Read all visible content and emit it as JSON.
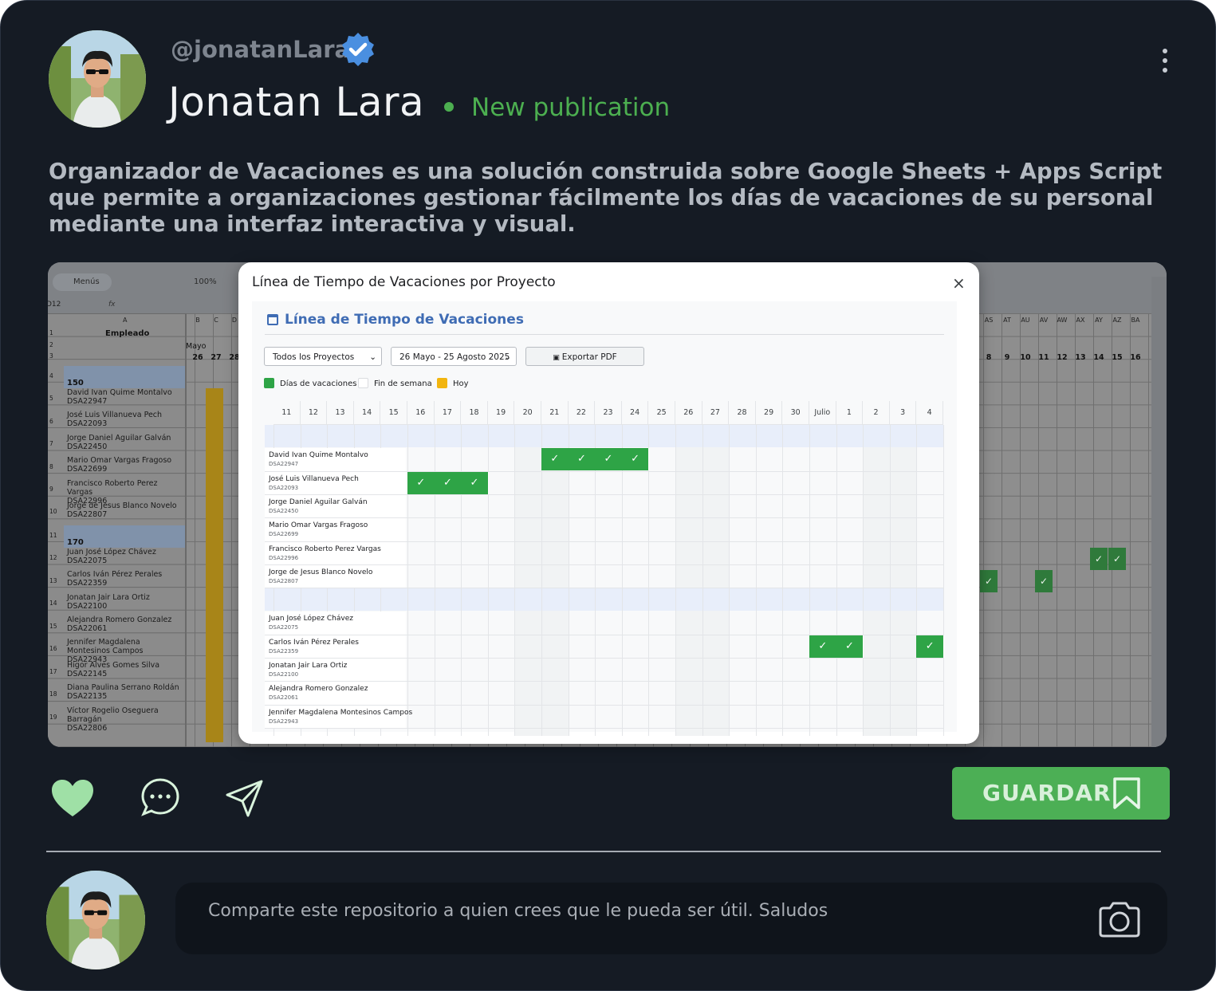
{
  "post": {
    "handle": "@jonatanLara",
    "name": "Jonatan Lara",
    "status": "New publication",
    "description": "Organizador de Vacaciones es una solución construida sobre Google Sheets + Apps Script que permite a organizaciones gestionar fácilmente los días de vacaciones de su personal mediante una interfaz interactiva y visual.",
    "accent_color": "#4caf50",
    "icons": [
      "verified-badge-icon",
      "kebab-menu-icon",
      "heart-icon",
      "comment-icon",
      "send-icon",
      "bookmark-icon",
      "camera-icon"
    ]
  },
  "screenshot": {
    "sheet": {
      "menu_search": "Menús",
      "zoom": "100%",
      "cell_ref": "D12",
      "formula_icon": "fx",
      "column_a": "A",
      "columns_left": [
        "B",
        "C",
        "D"
      ],
      "columns_right": [
        "AS",
        "AT",
        "AU",
        "AV",
        "AW",
        "AX",
        "AY",
        "AZ",
        "BA"
      ],
      "header_employee": "Empleado",
      "month": "Mayo",
      "days_left": [
        "26",
        "27",
        "28"
      ],
      "days_right": [
        "8",
        "9",
        "10",
        "11",
        "12",
        "13",
        "14",
        "15",
        "16"
      ],
      "row_numbers": [
        "1",
        "2",
        "3",
        "4",
        "5",
        "6",
        "7",
        "8",
        "9",
        "10",
        "11",
        "12",
        "13",
        "14",
        "15",
        "16",
        "17",
        "18",
        "19"
      ],
      "groups": [
        "150",
        "170"
      ],
      "employees": [
        [
          "David Ivan Quime Montalvo",
          "DSA22947"
        ],
        [
          "José Luis Villanueva Pech",
          "DSA22093"
        ],
        [
          "Jorge Daniel Aguilar Galván",
          "DSA22450"
        ],
        [
          "Mario Omar Vargas Fragoso",
          "DSA22699"
        ],
        [
          "Francisco Roberto Perez Vargas",
          "DSA22996"
        ],
        [
          "Jorge de Jesus Blanco Novelo",
          "DSA22807"
        ],
        [
          "Juan José López Chávez",
          "DSA22075"
        ],
        [
          "Carlos Iván Pérez Perales",
          "DSA22359"
        ],
        [
          "Jonatan Jair Lara Ortiz",
          "DSA22100"
        ],
        [
          "Alejandra Romero Gonzalez",
          "DSA22061"
        ],
        [
          "Jennifer Magdalena Montesinos Campos",
          "DSA22943"
        ],
        [
          "Higor Alves Gomes Silva",
          "DSA22145"
        ],
        [
          "Diana Paulina Serrano Roldán",
          "DSA22135"
        ],
        [
          "Víctor Rogelio Oseguera Barragán",
          "DSA22806"
        ]
      ]
    },
    "modal": {
      "title": "Línea de Tiempo de Vacaciones por Proyecto",
      "close": "×",
      "heading": "Línea de Tiempo de Vacaciones",
      "project_select": "Todos los Proyectos",
      "range_select": "26 Mayo - 25 Agosto 2025",
      "export_button": "Exportar PDF",
      "legend": [
        {
          "label": "Días de vacaciones",
          "color": "#2ea446"
        },
        {
          "label": "Fin de semana",
          "color": "#ffffff"
        },
        {
          "label": "Hoy",
          "color": "#f2b50f"
        }
      ],
      "days": [
        "11",
        "12",
        "13",
        "14",
        "15",
        "16",
        "17",
        "18",
        "19",
        "20",
        "21",
        "22",
        "23",
        "24",
        "25",
        "26",
        "27",
        "28",
        "29",
        "30",
        "Julio",
        "1",
        "2",
        "3",
        "4"
      ],
      "check": "✓",
      "rows": [
        {
          "name": "David Ivan Quime Montalvo",
          "id": "DSA22947",
          "vacation": [
            "21",
            "22",
            "23",
            "24"
          ]
        },
        {
          "name": "José Luis Villanueva Pech",
          "id": "DSA22093",
          "vacation": [
            "16",
            "17",
            "18"
          ]
        },
        {
          "name": "Jorge Daniel Aguilar Galván",
          "id": "DSA22450",
          "vacation": []
        },
        {
          "name": "Mario Omar Vargas Fragoso",
          "id": "DSA22699",
          "vacation": []
        },
        {
          "name": "Francisco Roberto Perez Vargas",
          "id": "DSA22996",
          "vacation": []
        },
        {
          "name": "Jorge de Jesus Blanco Novelo",
          "id": "DSA22807",
          "vacation": []
        },
        {
          "name": "Juan José López Chávez",
          "id": "DSA22075",
          "vacation": []
        },
        {
          "name": "Carlos Iván Pérez Perales",
          "id": "DSA22359",
          "vacation": [
            "Julio",
            "1",
            "4"
          ]
        },
        {
          "name": "Jonatan Jair Lara Ortiz",
          "id": "DSA22100",
          "vacation": []
        },
        {
          "name": "Alejandra Romero Gonzalez",
          "id": "DSA22061",
          "vacation": []
        },
        {
          "name": "Jennifer Magdalena Montesinos Campos",
          "id": "DSA22943",
          "vacation": []
        }
      ]
    }
  },
  "actions": {
    "save_label": "GUARDAR"
  },
  "comment": {
    "placeholder": "Comparte este repositorio a quien crees que le pueda ser útil. Saludos"
  }
}
